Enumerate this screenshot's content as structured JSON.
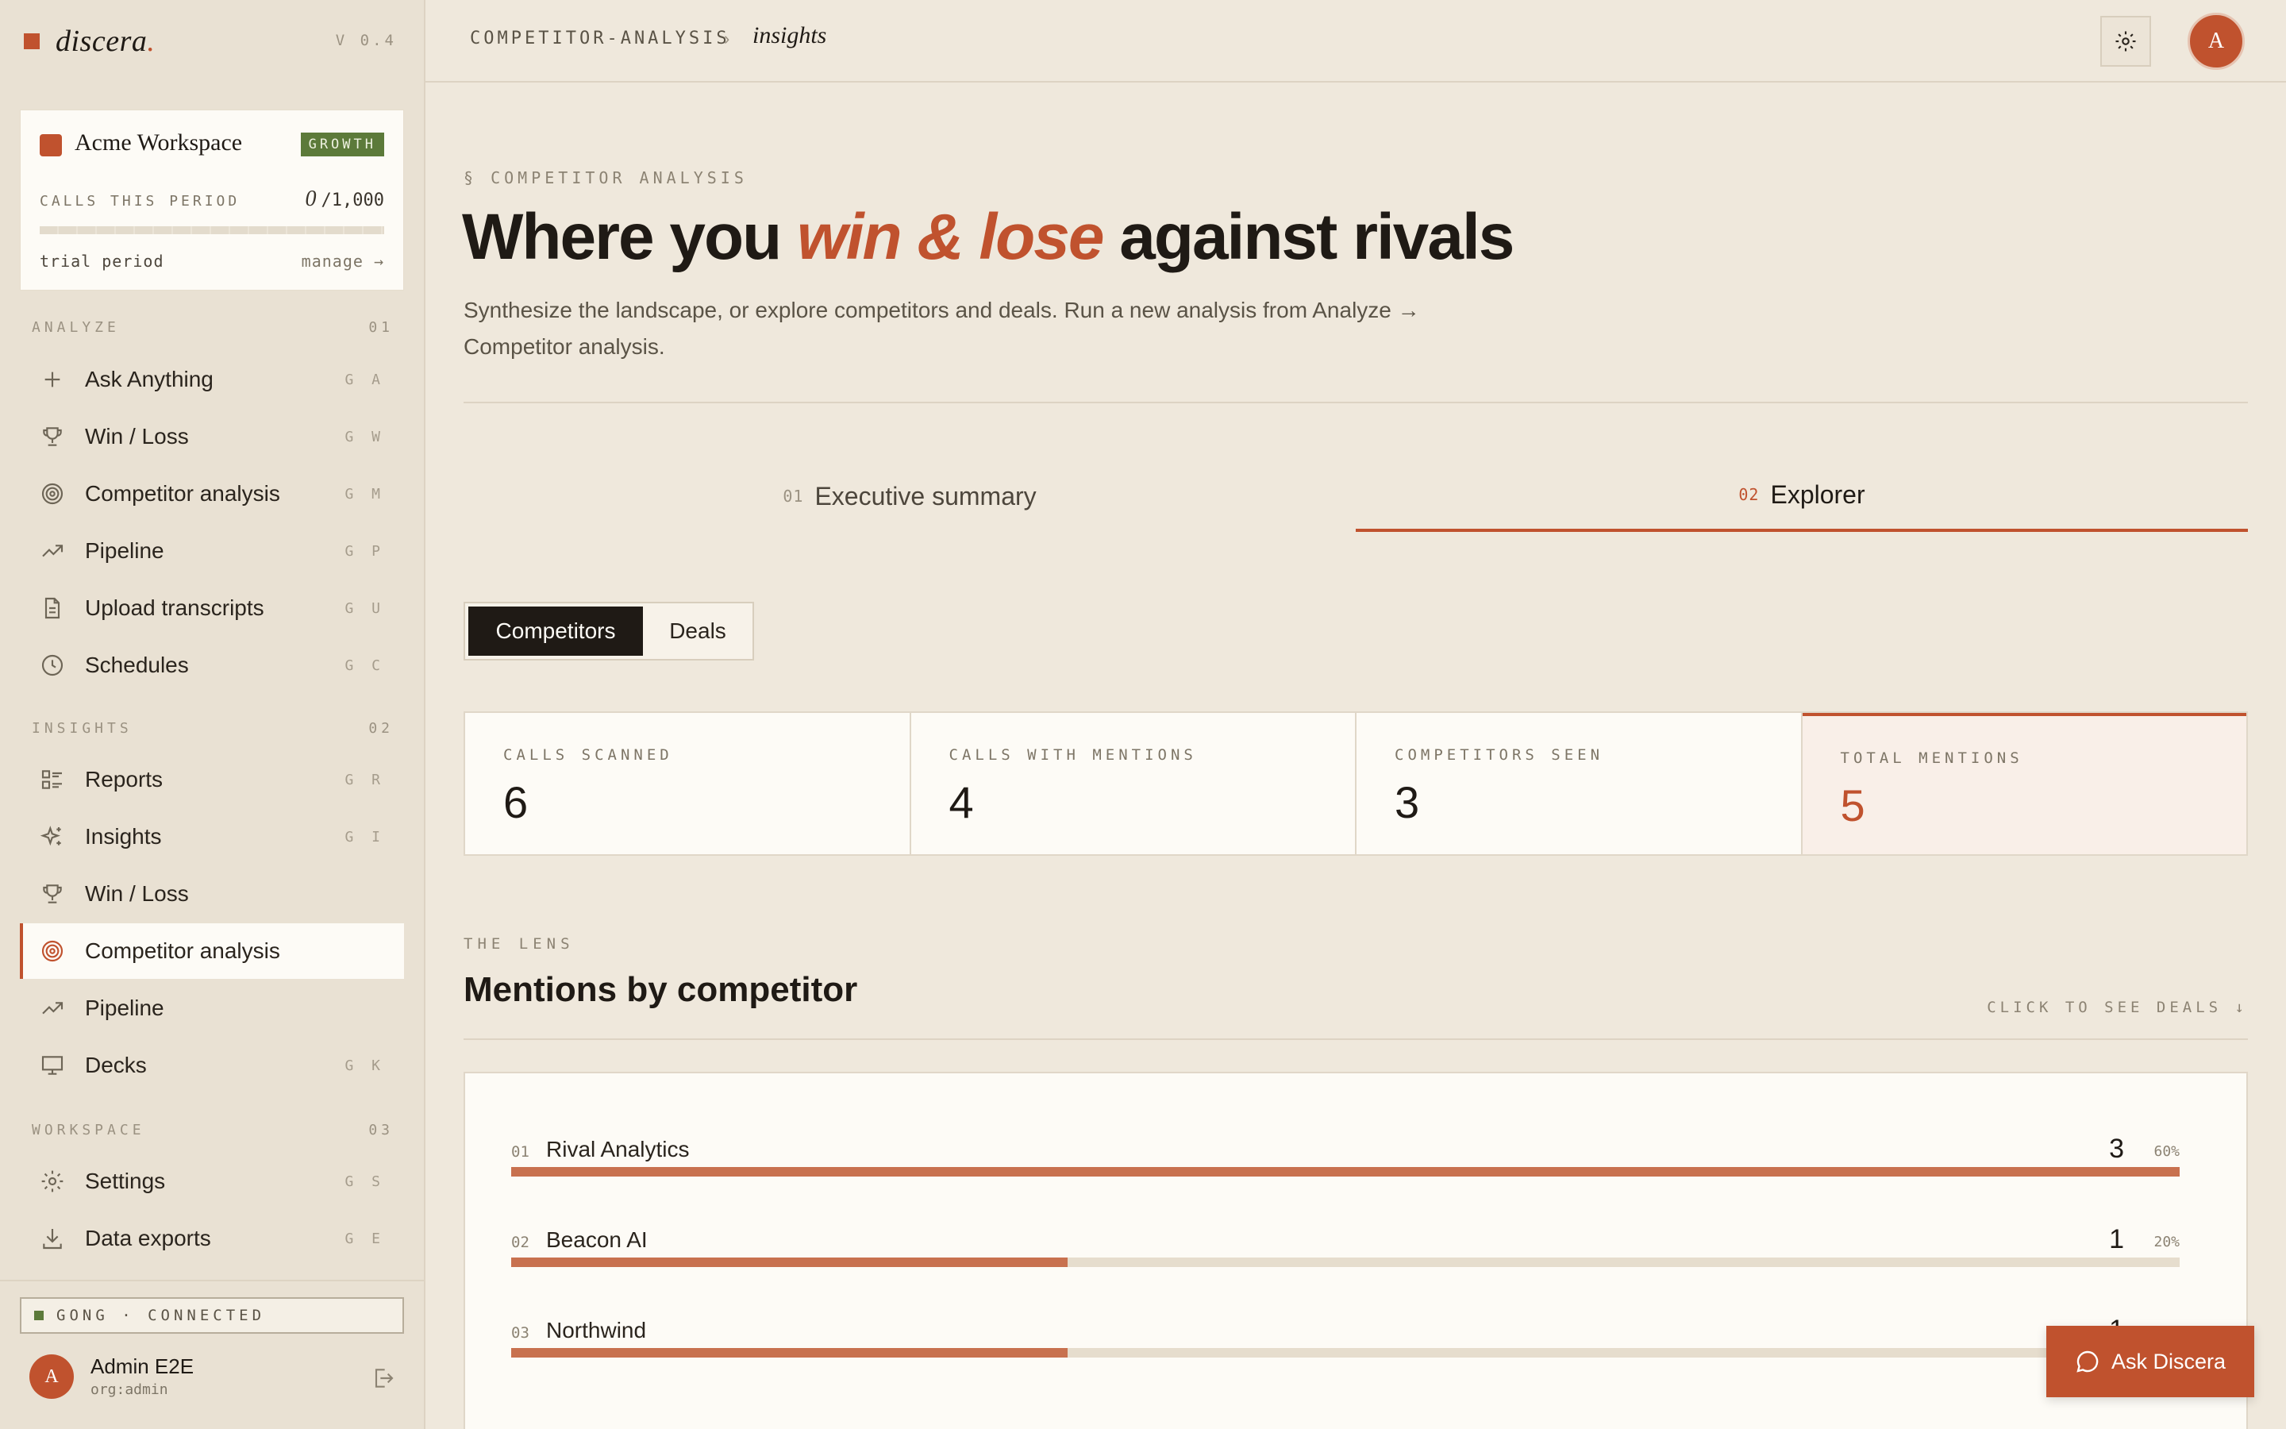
{
  "brand": {
    "name": "discera",
    "dot": ".",
    "version": "V 0.4"
  },
  "workspace": {
    "name": "Acme Workspace",
    "plan": "GROWTH",
    "calls_label": "CALLS THIS PERIOD",
    "calls_used": "0",
    "calls_limit": "/1,000",
    "calls_progress": 0,
    "trial": "trial period",
    "manage": "manage →"
  },
  "sidebar": {
    "analyze": {
      "title": "ANALYZE",
      "num": "01",
      "items": [
        {
          "label": "Ask Anything",
          "shortcut": "G A",
          "icon": "plus-icon"
        },
        {
          "label": "Win / Loss",
          "shortcut": "G W",
          "icon": "trophy-icon"
        },
        {
          "label": "Competitor analysis",
          "shortcut": "G M",
          "icon": "target-icon"
        },
        {
          "label": "Pipeline",
          "shortcut": "G P",
          "icon": "trend-icon"
        },
        {
          "label": "Upload transcripts",
          "shortcut": "G U",
          "icon": "document-icon"
        },
        {
          "label": "Schedules",
          "shortcut": "G C",
          "icon": "clock-icon"
        }
      ]
    },
    "insights": {
      "title": "INSIGHTS",
      "num": "02",
      "items": [
        {
          "label": "Reports",
          "shortcut": "G R",
          "icon": "list-icon"
        },
        {
          "label": "Insights",
          "shortcut": "G I",
          "icon": "sparkle-icon"
        },
        {
          "label": "Win / Loss",
          "shortcut": "",
          "icon": "trophy-icon"
        },
        {
          "label": "Competitor analysis",
          "shortcut": "",
          "icon": "target-icon",
          "active": true
        },
        {
          "label": "Pipeline",
          "shortcut": "",
          "icon": "trend-icon"
        },
        {
          "label": "Decks",
          "shortcut": "G K",
          "icon": "presentation-icon"
        }
      ]
    },
    "workspace": {
      "title": "WORKSPACE",
      "num": "03",
      "items": [
        {
          "label": "Settings",
          "shortcut": "G S",
          "icon": "gear-icon"
        },
        {
          "label": "Data exports",
          "shortcut": "G E",
          "icon": "download-icon"
        }
      ]
    },
    "integration": "GONG · CONNECTED",
    "user": {
      "initial": "A",
      "name": "Admin E2E",
      "org": "org:admin"
    }
  },
  "topbar": {
    "breadcrumb_1": "COMPETITOR-ANALYSIS",
    "breadcrumb_sep": "›",
    "breadcrumb_2": "insights",
    "avatar_initial": "A"
  },
  "hero": {
    "eyebrow": "§ COMPETITOR ANALYSIS",
    "title_pre": "Where you ",
    "title_em": "win & lose",
    "title_post": " against rivals",
    "lede": "Synthesize the landscape, or explore competitors and deals. Run a new analysis from Analyze → Competitor analysis."
  },
  "tabs": [
    {
      "num": "01",
      "label": "Executive summary",
      "active": false
    },
    {
      "num": "02",
      "label": "Explorer",
      "active": true
    }
  ],
  "segment": {
    "on": "Competitors",
    "off": "Deals"
  },
  "stats": [
    {
      "label": "CALLS SCANNED",
      "value": "6"
    },
    {
      "label": "CALLS WITH MENTIONS",
      "value": "4"
    },
    {
      "label": "COMPETITORS SEEN",
      "value": "3"
    },
    {
      "label": "TOTAL MENTIONS",
      "value": "5"
    }
  ],
  "lens": {
    "eyebrow": "THE LENS",
    "title": "Mentions by competitor",
    "link": "CLICK TO SEE DEALS ↓"
  },
  "chart_data": {
    "type": "bar",
    "categories": [
      "Rival Analytics",
      "Beacon AI",
      "Northwind"
    ],
    "ranks": [
      "01",
      "02",
      "03"
    ],
    "values": [
      3,
      1,
      1
    ],
    "percents": [
      "60%",
      "20%",
      "20%"
    ],
    "xlim": [
      0,
      3
    ]
  },
  "ask_button": "Ask Discera",
  "colors": {
    "accent": "#c0522e",
    "bar": "#c8714f",
    "background": "#efe8dc",
    "plan_badge": "#5c7a3a"
  }
}
